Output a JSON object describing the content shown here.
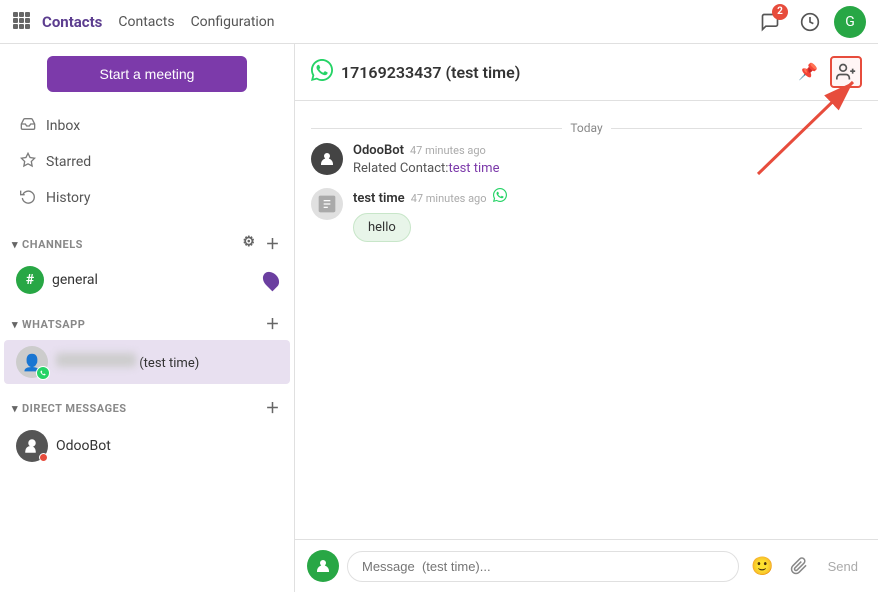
{
  "topnav": {
    "brand": "Contacts",
    "links": [
      "Contacts",
      "Configuration"
    ],
    "notification_count": "2",
    "green_initial": "G"
  },
  "sidebar": {
    "start_meeting": "Start a meeting",
    "nav_items": [
      {
        "id": "inbox",
        "label": "Inbox",
        "icon": "📥"
      },
      {
        "id": "starred",
        "label": "Starred",
        "icon": "☆"
      },
      {
        "id": "history",
        "label": "History",
        "icon": "↺"
      }
    ],
    "channels_label": "CHANNELS",
    "channels": [
      {
        "id": "general",
        "name": "general"
      }
    ],
    "whatsapp_label": "WHATSAPP",
    "whatsapp_contact": "(test time)",
    "direct_messages_label": "DIRECT MESSAGES",
    "dm_contacts": [
      {
        "id": "odoobot",
        "name": "OdooBot"
      }
    ]
  },
  "chat": {
    "title": "17169233437 (test time)",
    "pin_icon": "📌",
    "add_user_icon": "👤+",
    "date_divider": "Today",
    "messages": [
      {
        "id": "msg1",
        "sender": "OdooBot",
        "time": "47 minutes ago",
        "body_prefix": "Related Contact:",
        "body_link": "test time",
        "type": "bot"
      },
      {
        "id": "msg2",
        "sender": "test time",
        "time": "47 minutes ago",
        "bubble": "hello",
        "type": "contact",
        "wa": true
      }
    ],
    "input_placeholder": "Message  (test time)..."
  }
}
